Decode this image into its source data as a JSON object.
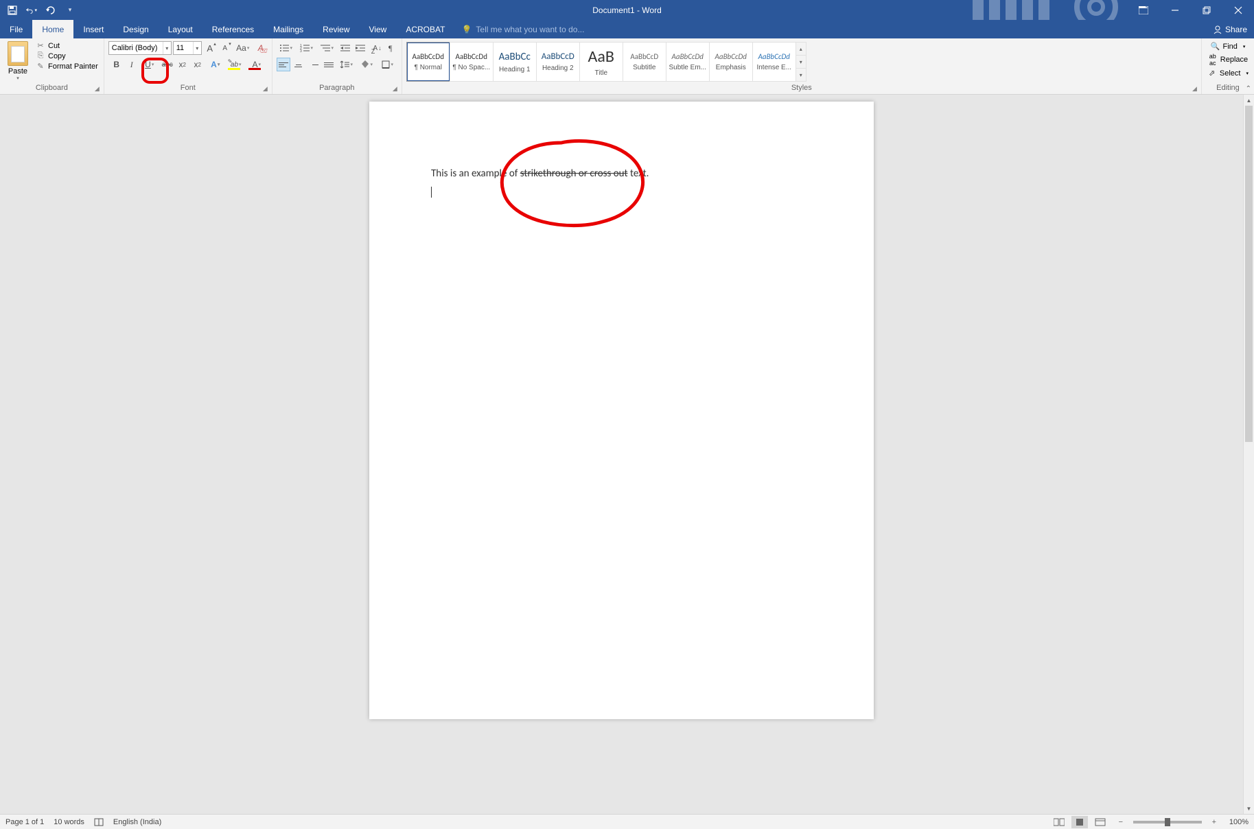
{
  "title": "Document1 - Word",
  "qat": {
    "save": "💾",
    "undo": "↶",
    "redo": "↻",
    "customize": "▾"
  },
  "tabs": {
    "file": "File",
    "home": "Home",
    "insert": "Insert",
    "design": "Design",
    "layout": "Layout",
    "references": "References",
    "mailings": "Mailings",
    "review": "Review",
    "view": "View",
    "acrobat": "ACROBAT"
  },
  "tell_me": "Tell me what you want to do...",
  "share": "Share",
  "clipboard": {
    "paste": "Paste",
    "cut": "Cut",
    "copy": "Copy",
    "format_painter": "Format Painter",
    "label": "Clipboard"
  },
  "font": {
    "name": "Calibri (Body)",
    "size": "11",
    "label": "Font",
    "bold": "B",
    "italic": "I",
    "underline": "U",
    "strike": "abc",
    "sub": "x",
    "sup": "x",
    "effects": "A",
    "highlight": "ab",
    "color": "A",
    "growA": "A",
    "shrinkA": "A",
    "caseAa": "Aa",
    "clear": "A"
  },
  "paragraph": {
    "label": "Paragraph"
  },
  "styles": {
    "label": "Styles",
    "items": [
      {
        "preview": "AaBbCcDd",
        "name": "¶ Normal",
        "color": "#333",
        "fs": "11px"
      },
      {
        "preview": "AaBbCcDd",
        "name": "¶ No Spac...",
        "color": "#333",
        "fs": "11px"
      },
      {
        "preview": "AaBbCc",
        "name": "Heading 1",
        "color": "#1f4e79",
        "fs": "15px"
      },
      {
        "preview": "AaBbCcD",
        "name": "Heading 2",
        "color": "#1f4e79",
        "fs": "13px"
      },
      {
        "preview": "AaB",
        "name": "Title",
        "color": "#333",
        "fs": "24px"
      },
      {
        "preview": "AaBbCcD",
        "name": "Subtitle",
        "color": "#666",
        "fs": "11px"
      },
      {
        "preview": "AaBbCcDd",
        "name": "Subtle Em...",
        "color": "#666",
        "fs": "11px",
        "italic": true
      },
      {
        "preview": "AaBbCcDd",
        "name": "Emphasis",
        "color": "#666",
        "fs": "11px",
        "italic": true
      },
      {
        "preview": "AaBbCcDd",
        "name": "Intense E...",
        "color": "#2e74b5",
        "fs": "11px",
        "italic": true
      }
    ]
  },
  "editing": {
    "label": "Editing",
    "find": "Find",
    "replace": "Replace",
    "select": "Select"
  },
  "document": {
    "text_before": "This is an example of ",
    "text_strike": "strikethrough or cross out",
    "text_after": " text."
  },
  "statusbar": {
    "page": "Page 1 of 1",
    "words": "10 words",
    "lang": "English (India)",
    "zoom": "100%"
  }
}
